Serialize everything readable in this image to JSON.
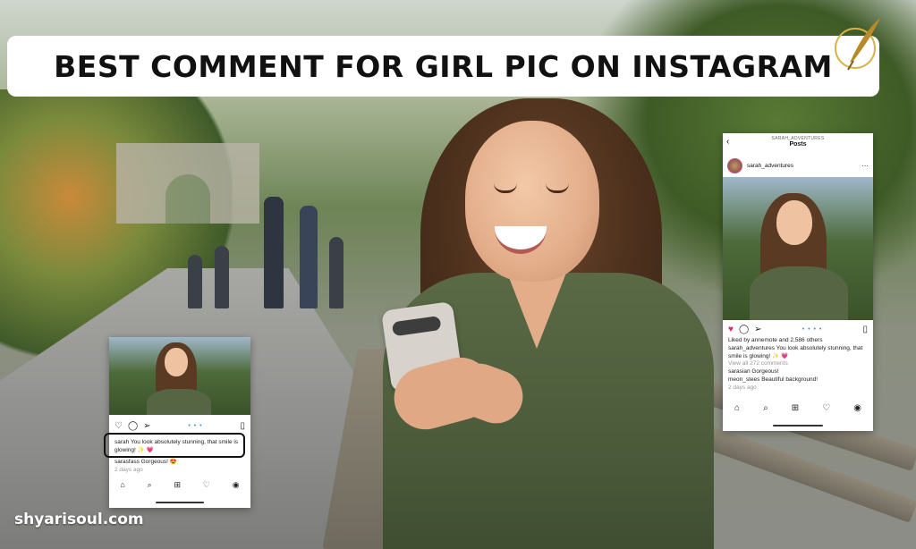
{
  "banner": {
    "title": "BEST COMMENT FOR GIRL PIC ON INSTAGRAM"
  },
  "watermark": {
    "site": "shyarisoul.com"
  },
  "left_post": {
    "comment_highlighted": "sarah You look absolutely stunning, that smile is glowing!",
    "comment_2": "sarasfass Gorgeous!",
    "time": "2 days ago",
    "emoji_1": "✨ 💗",
    "emoji_2": "😍"
  },
  "right_post": {
    "header_user": "SARAH_ADVENTURES",
    "header_title": "Posts",
    "username": "sarah_adventures",
    "likes": "Liked by annemote and 2,586 others",
    "caption": "sarah_adventures You look absolutely stunning, that smile is glowing!",
    "caption_emoji": "✨ 💗",
    "view_comments": "View all 272 comments",
    "comment_1": "sarasian Gorgeous!",
    "comment_2": "meon_stees Beautiful background!",
    "time": "2 days ago"
  },
  "icons": {
    "heart": "heart-icon",
    "comment": "comment-icon",
    "share": "share-icon",
    "bookmark": "bookmark-icon",
    "home": "home-icon",
    "search": "search-icon",
    "add": "add-post-icon",
    "activity": "heart-icon",
    "profile": "profile-icon",
    "more": "more-icon",
    "back": "back-icon"
  },
  "colors": {
    "like_red": "#e0245e",
    "dot_blue": "#3a8ee6",
    "banner_bg": "#ffffff"
  }
}
